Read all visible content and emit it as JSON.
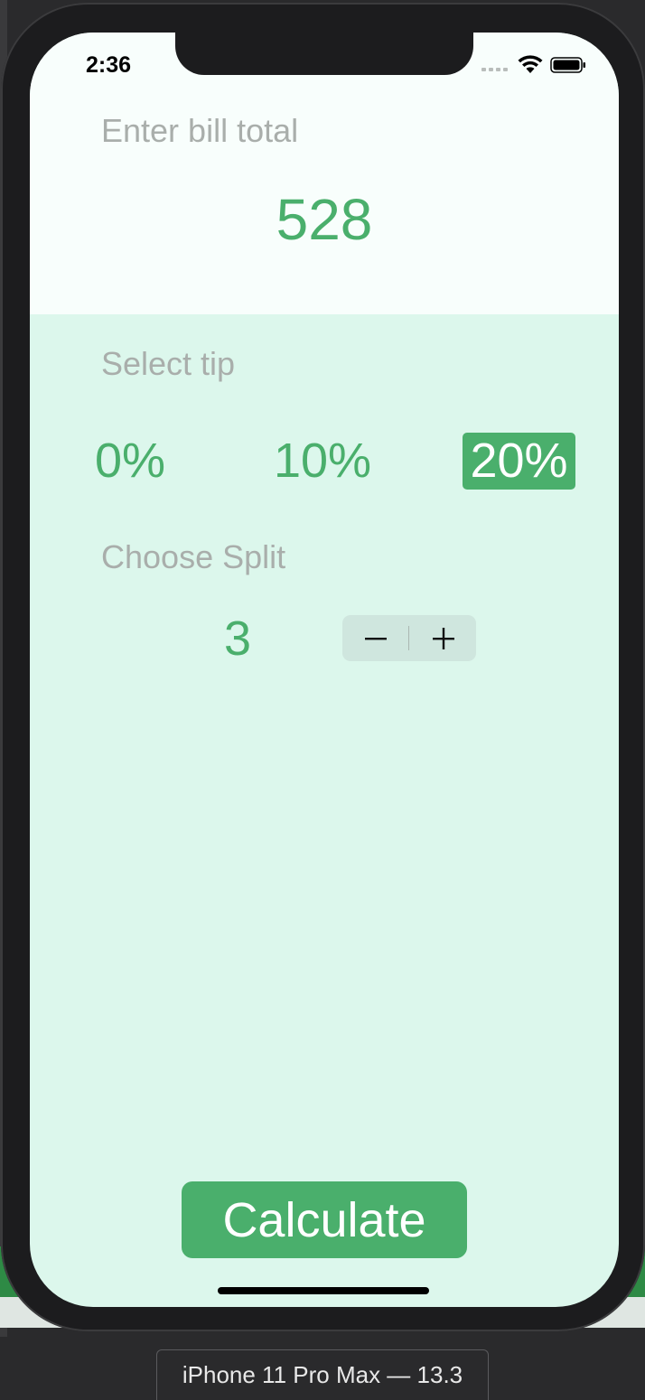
{
  "status_bar": {
    "time": "2:36"
  },
  "bill": {
    "label": "Enter bill total",
    "value": "528"
  },
  "tip": {
    "label": "Select tip",
    "options": [
      "0%",
      "10%",
      "20%"
    ],
    "selected": "20%"
  },
  "split": {
    "label": "Choose Split",
    "value": "3",
    "decrement_label": "−",
    "increment_label": "+"
  },
  "calculate_label": "Calculate",
  "simulator": {
    "device_label": "iPhone 11 Pro Max — 13.3"
  },
  "colors": {
    "accent": "#4aaf6c",
    "top_background": "#f8fefc",
    "body_background": "#dcf7ec",
    "label_gray": "#a9aeab"
  }
}
